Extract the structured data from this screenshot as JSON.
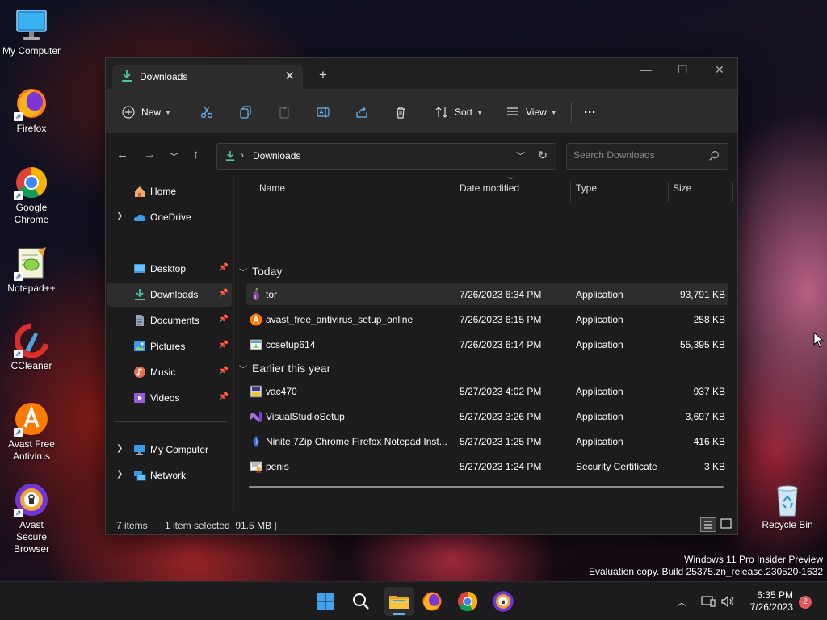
{
  "desktop": {
    "icons": [
      {
        "label": "My Computer",
        "icon": "monitor-icon"
      },
      {
        "label": "Firefox",
        "icon": "firefox-icon"
      },
      {
        "label": "Google Chrome",
        "icon": "chrome-icon"
      },
      {
        "label": "Notepad++",
        "icon": "notepadpp-icon"
      },
      {
        "label": "CCleaner",
        "icon": "ccleaner-icon"
      },
      {
        "label": "Avast Free Antivirus",
        "icon": "avast-icon"
      },
      {
        "label": "Avast Secure Browser",
        "icon": "avast-browser-icon"
      }
    ],
    "recycle_bin": "Recycle Bin"
  },
  "window": {
    "tab_title": "Downloads",
    "toolbar": {
      "new_label": "New",
      "sort_label": "Sort",
      "view_label": "View",
      "more_label": "···"
    },
    "address": {
      "crumb_sep": "›",
      "location": "Downloads",
      "search_placeholder": "Search Downloads"
    },
    "sidebar": {
      "home": "Home",
      "onedrive": "OneDrive",
      "desktop": "Desktop",
      "downloads": "Downloads",
      "documents": "Documents",
      "pictures": "Pictures",
      "music": "Music",
      "videos": "Videos",
      "my_computer": "My Computer",
      "network": "Network"
    },
    "columns": {
      "name": "Name",
      "date": "Date modified",
      "type": "Type",
      "size": "Size"
    },
    "groups": [
      {
        "title": "Today",
        "files": [
          {
            "name": "tor",
            "date": "7/26/2023 6:34 PM",
            "type": "Application",
            "size": "93,791 KB"
          },
          {
            "name": "avast_free_antivirus_setup_online",
            "date": "7/26/2023 6:15 PM",
            "type": "Application",
            "size": "258 KB"
          },
          {
            "name": "ccsetup614",
            "date": "7/26/2023 6:14 PM",
            "type": "Application",
            "size": "55,395 KB"
          }
        ]
      },
      {
        "title": "Earlier this year",
        "files": [
          {
            "name": "vac470",
            "date": "5/27/2023 4:02 PM",
            "type": "Application",
            "size": "937 KB"
          },
          {
            "name": "VisualStudioSetup",
            "date": "5/27/2023 3:26 PM",
            "type": "Application",
            "size": "3,697 KB"
          },
          {
            "name": "Ninite 7Zip Chrome Firefox Notepad Inst...",
            "date": "5/27/2023 1:25 PM",
            "type": "Application",
            "size": "416 KB"
          },
          {
            "name": "penis",
            "date": "5/27/2023 1:24 PM",
            "type": "Security Certificate",
            "size": "3 KB"
          }
        ]
      }
    ],
    "status": {
      "items": "7 items",
      "selected": "1 item selected  91.5 MB"
    }
  },
  "watermark": {
    "line1": "Windows 11 Pro Insider Preview",
    "line2": "Evaluation copy. Build 25375.zn_release.230520-1632"
  },
  "taskbar": {
    "time": "6:35 PM",
    "date": "7/26/2023",
    "notifications": "2"
  },
  "colors": {
    "accent": "#4cc2a0",
    "folder": "#f5c242",
    "window_bg": "#1c1c1c",
    "toolbar_bg": "#2c2c2c"
  }
}
